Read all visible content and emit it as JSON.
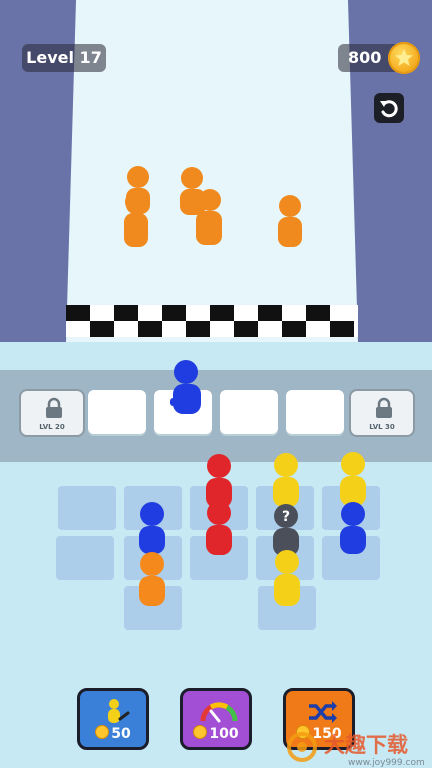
{
  "hud": {
    "level_text": "Level 17",
    "coins": "800"
  },
  "slots": {
    "locked_left_label": "LVL 20",
    "locked_right_label": "LVL 30"
  },
  "shop": {
    "add_unit_price": "50",
    "upgrade_price": "100",
    "shuffle_price": "150"
  },
  "enemy_colors": {
    "orange": "#f08a1e"
  },
  "unit_colors": {
    "blue": "#1f3de0",
    "red": "#e0262a",
    "yellow": "#f5d019",
    "orange": "#f5891c",
    "gray": "#4a4f5a"
  },
  "icons": [
    "undo-icon",
    "coin-icon",
    "lock-icon",
    "add-unit-icon",
    "speedometer-icon",
    "shuffle-icon"
  ],
  "watermark": {
    "text": "大趣下载",
    "url": "www.joy999.com"
  }
}
